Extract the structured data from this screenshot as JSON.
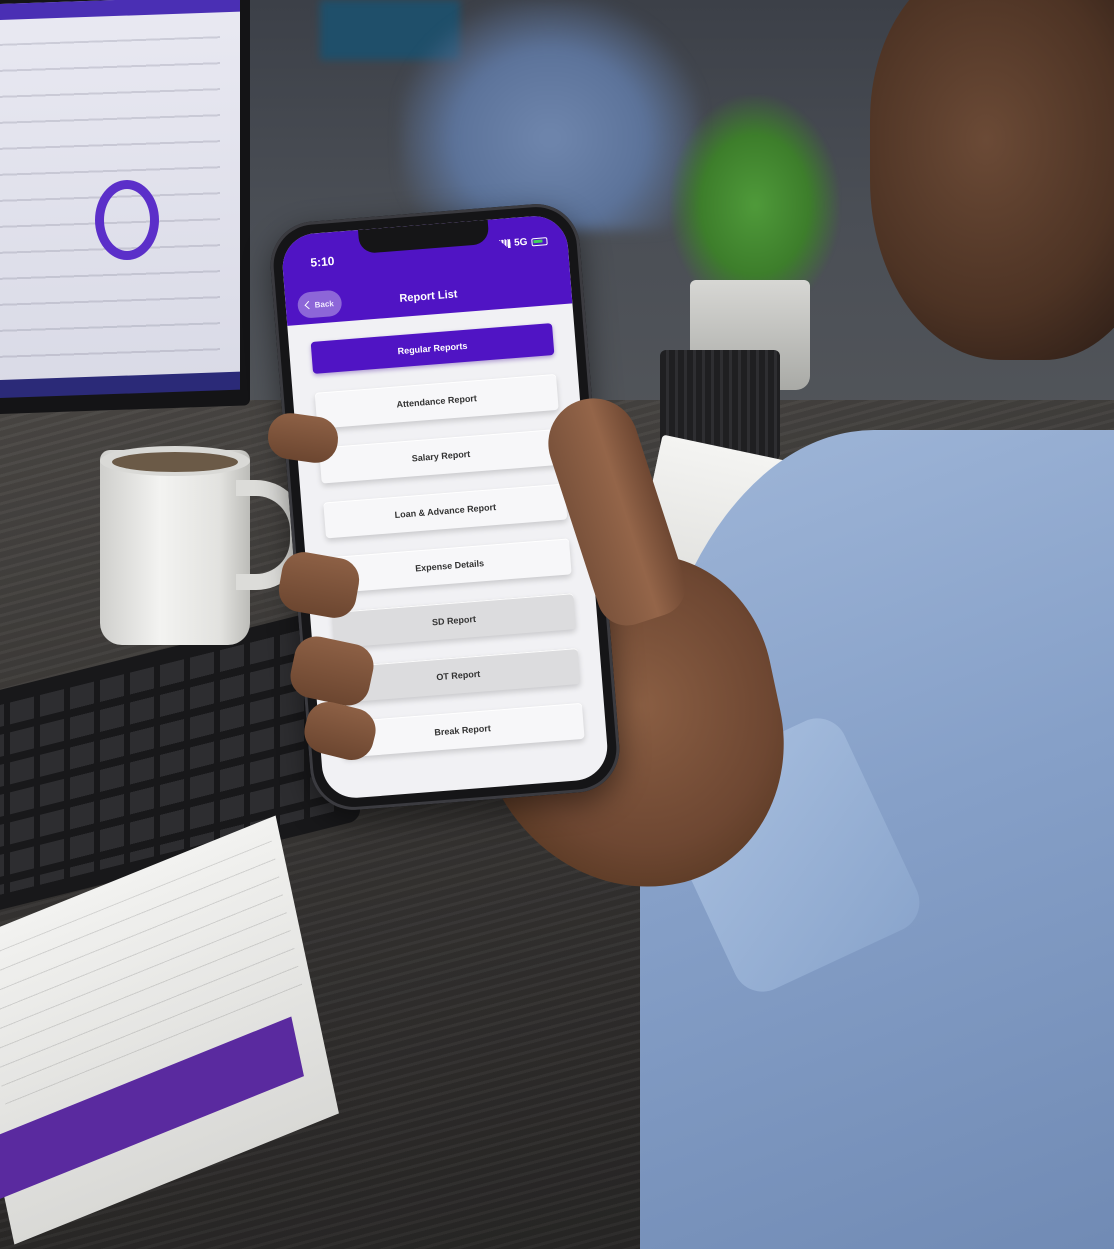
{
  "status_bar": {
    "time": "5:10",
    "network": "5G",
    "signal_icon": "signal-icon",
    "battery_icon": "battery-icon"
  },
  "header": {
    "back_label": "Back",
    "back_icon": "chevron-left-icon",
    "title": "Report List",
    "color": "#5014c4"
  },
  "reports": [
    {
      "label": "Regular Reports",
      "state": "active"
    },
    {
      "label": "Attendance Report",
      "state": "normal"
    },
    {
      "label": "Salary Report",
      "state": "normal"
    },
    {
      "label": "Loan & Advance Report",
      "state": "normal"
    },
    {
      "label": "Expense Details",
      "state": "normal"
    },
    {
      "label": "SD Report",
      "state": "dim"
    },
    {
      "label": "OT Report",
      "state": "dim"
    },
    {
      "label": "Break Report",
      "state": "normal"
    }
  ]
}
